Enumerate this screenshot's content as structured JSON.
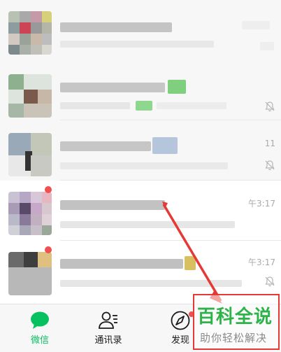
{
  "chats": [
    {
      "time": "",
      "muted": false
    },
    {
      "time": "",
      "muted": true
    },
    {
      "time": "11",
      "muted": true
    },
    {
      "time": "午3:17",
      "muted": false
    },
    {
      "time": "午3:17",
      "muted": true
    }
  ],
  "tabs": [
    {
      "label": "微信",
      "icon": "chat-bubble-icon",
      "active": true
    },
    {
      "label": "通讯录",
      "icon": "contacts-icon",
      "active": false
    },
    {
      "label": "发现",
      "icon": "compass-icon",
      "active": false
    }
  ],
  "watermark": {
    "title": "百科全说",
    "subtitle": "助你轻松解决"
  },
  "colors": {
    "accent": "#07c160",
    "annotation": "#e53935"
  }
}
